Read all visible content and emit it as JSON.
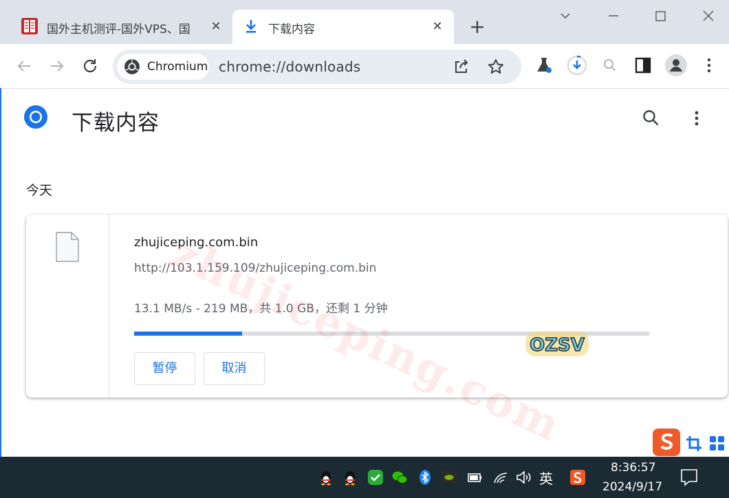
{
  "browser": {
    "tabs": [
      {
        "title": "国外主机测评-国外VPS、国",
        "close": "✕",
        "favicon": "site-logo-icon"
      },
      {
        "title": "下载内容",
        "close": "✕",
        "favicon": "download-icon"
      }
    ],
    "new_tab": "+",
    "omnibox": {
      "chip_label": "Chromium",
      "url": "chrome://downloads"
    }
  },
  "page": {
    "title": "下载内容",
    "date_group": "今天",
    "download": {
      "file_name": "zhujiceping.com.bin",
      "url": "http://103.1.159.109/zhujiceping.com.bin",
      "status": "13.1 MB/s - 219 MB，共 1.0 GB，还剩 1 分钟",
      "progress_fraction": 0.21,
      "pause_label": "暂停",
      "cancel_label": "取消"
    }
  },
  "overlay": {
    "watermark": "zhujiceping.com",
    "sticker_text": "OZSV"
  },
  "taskbar": {
    "ime": "英",
    "time": "8:36:57",
    "date": "2024/9/17"
  },
  "colors": {
    "accent": "#1a73e8",
    "tabstrip": "#dee3eb",
    "taskbar": "#1c2a33",
    "omnibox": "#e8edf3"
  }
}
